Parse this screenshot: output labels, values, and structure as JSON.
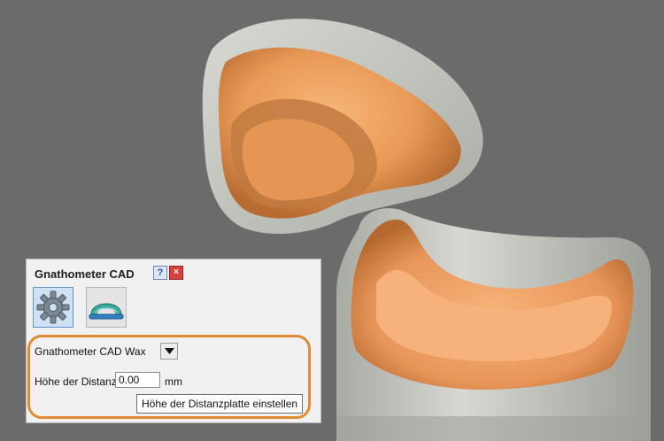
{
  "panel": {
    "title": "Gnathometer CAD",
    "help_label": "?",
    "close_label": "×",
    "modes": [
      {
        "icon": "gear-icon"
      },
      {
        "icon": "arch-icon"
      }
    ],
    "mode_combo": {
      "selected": "Gnathometer CAD Wax"
    },
    "height_field": {
      "label": "Höhe der Distanzplatte",
      "value": "0.00",
      "unit": "mm"
    }
  },
  "tooltip": {
    "text": "Höhe der Distanzplatte einstellen"
  },
  "colors": {
    "background": "#6b6b6b",
    "wax": "#f0a262",
    "model": "#c9cbc4",
    "highlight": "#e08a32"
  }
}
